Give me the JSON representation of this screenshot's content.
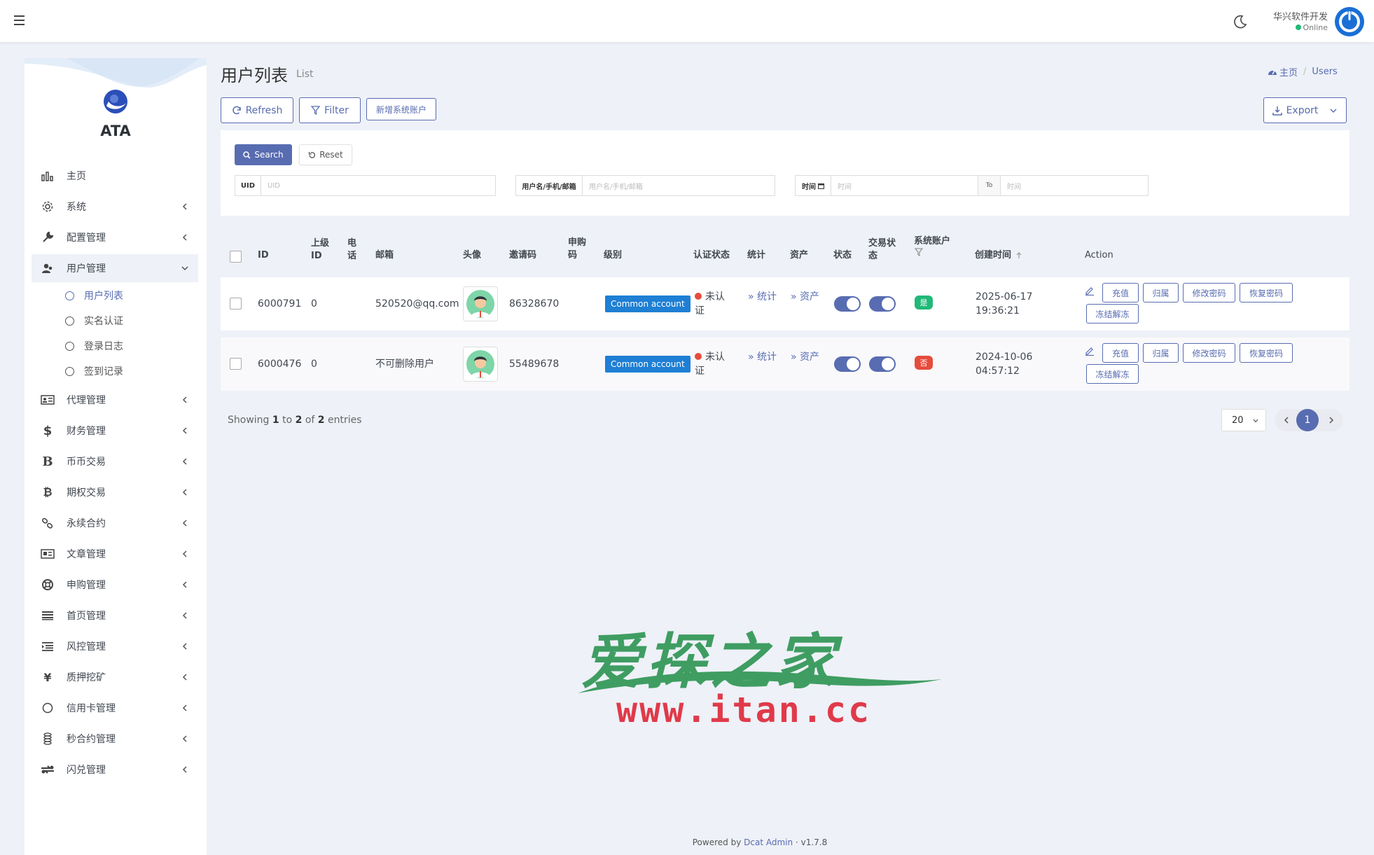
{
  "navbar": {
    "user_name": "华兴软件开发",
    "user_status": "Online"
  },
  "sidebar": {
    "brand": "ATA",
    "items": [
      {
        "label": "主页",
        "icon": "bar-chart-icon"
      },
      {
        "label": "系统",
        "icon": "gear-icon"
      },
      {
        "label": "配置管理",
        "icon": "wrench-icon"
      },
      {
        "label": "用户管理",
        "icon": "users-icon"
      },
      {
        "label": "代理管理",
        "icon": "id-card-icon"
      },
      {
        "label": "财务管理",
        "icon": "dollar-icon"
      },
      {
        "label": "币币交易",
        "icon": "bitcoin-b-icon"
      },
      {
        "label": "期权交易",
        "icon": "bitcoin-icon"
      },
      {
        "label": "永续合约",
        "icon": "link-icon"
      },
      {
        "label": "文章管理",
        "icon": "newspaper-icon"
      },
      {
        "label": "申购管理",
        "icon": "lifebuoy-icon"
      },
      {
        "label": "首页管理",
        "icon": "list-icon"
      },
      {
        "label": "风控管理",
        "icon": "indent-icon"
      },
      {
        "label": "质押挖矿",
        "icon": "yen-icon"
      },
      {
        "label": "信用卡管理",
        "icon": "circle-icon"
      },
      {
        "label": "秒合约管理",
        "icon": "coins-icon"
      },
      {
        "label": "闪兑管理",
        "icon": "exchange-icon"
      }
    ],
    "sub_items": [
      "用户列表",
      "实名认证",
      "登录日志",
      "签到记录"
    ]
  },
  "header": {
    "title": "用户列表",
    "subtitle": "List",
    "breadcrumb_home": "主页",
    "breadcrumb_current": "Users"
  },
  "toolbar": {
    "refresh": "Refresh",
    "filter": "Filter",
    "add_system_account": "新增系统账户",
    "export": "Export"
  },
  "filter": {
    "search": "Search",
    "reset": "Reset",
    "uid_label": "UID",
    "uid_placeholder": "UID",
    "user_label": "用户名/手机/邮箱",
    "user_placeholder": "用户名/手机/邮箱",
    "time_label": "时间",
    "time_placeholder": "时间",
    "to_label": "To",
    "time_to_placeholder": "时间"
  },
  "table": {
    "headers": {
      "id": "ID",
      "parent_id": "上级ID",
      "phone": "电话",
      "email": "邮箱",
      "avatar": "头像",
      "invite_code": "邀请码",
      "purchase_code": "申购码",
      "level": "级别",
      "auth_status": "认证状态",
      "stats": "统计",
      "assets": "资产",
      "status": "状态",
      "trade_status": "交易状态",
      "system_account": "系统账户",
      "created_at": "创建时间",
      "action": "Action"
    },
    "rows": [
      {
        "id": "6000791",
        "parent_id": "0",
        "phone": "",
        "email": "520520@qq.com",
        "invite_code": "86328670",
        "purchase_code": "",
        "level": "Common account",
        "auth_status": "未认证",
        "stats": "» 统计",
        "assets": "» 资产",
        "status_on": true,
        "trade_on": true,
        "system_account": "是",
        "system_account_color": "#21b978",
        "created_date": "2025-06-17",
        "created_time": "19:36:21"
      },
      {
        "id": "6000476",
        "parent_id": "0",
        "phone": "",
        "email": "不可删除用户",
        "invite_code": "55489678",
        "purchase_code": "",
        "level": "Common account",
        "auth_status": "未认证",
        "stats": "» 统计",
        "assets": "» 资产",
        "status_on": true,
        "trade_on": true,
        "system_account": "否",
        "system_account_color": "#e64c3c",
        "created_date": "2024-10-06",
        "created_time": "04:57:12"
      }
    ],
    "actions": [
      "充值",
      "归属",
      "修改密码",
      "恢复密码",
      "冻结解冻"
    ]
  },
  "pagination": {
    "showing_prefix": "Showing",
    "from": "1",
    "to_word": "to",
    "to": "2",
    "of_word": "of",
    "total": "2",
    "suffix": "entries",
    "per_page": "20",
    "current_page": "1"
  },
  "watermark": {
    "text": "爱探之家",
    "url": "www.itan.cc"
  },
  "footer": {
    "powered_by": "Powered by",
    "link": "Dcat Admin",
    "sep": "·",
    "version": "v1.7.8"
  },
  "colors": {
    "primary": "#586cb1",
    "badge_blue": "#1e7fd4",
    "success": "#21b978",
    "danger": "#e64c3c",
    "background": "#eef1f7"
  }
}
